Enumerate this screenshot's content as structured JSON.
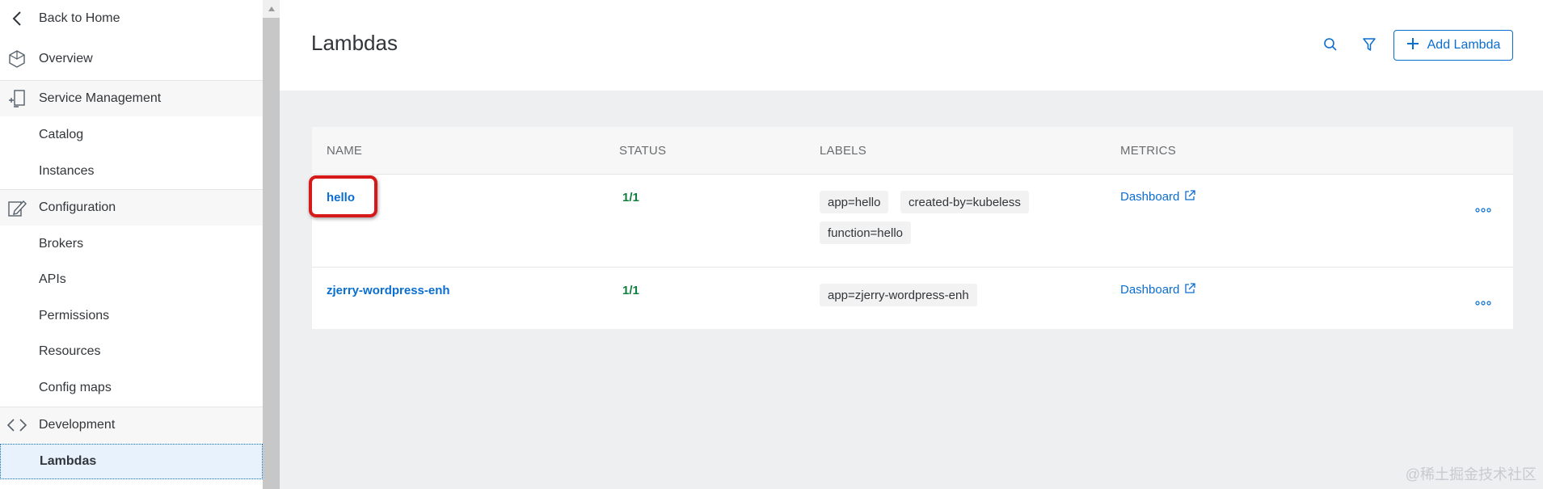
{
  "sidebar": {
    "back_label": "Back to Home",
    "items": [
      {
        "label": "Overview",
        "icon": "overview-icon"
      },
      {
        "label": "Service Management",
        "icon": "service-management-icon"
      },
      {
        "label": "Catalog"
      },
      {
        "label": "Instances"
      },
      {
        "label": "Configuration",
        "icon": "configuration-icon"
      },
      {
        "label": "Brokers"
      },
      {
        "label": "APIs"
      },
      {
        "label": "Permissions"
      },
      {
        "label": "Resources"
      },
      {
        "label": "Config maps"
      },
      {
        "label": "Development",
        "icon": "code-icon"
      },
      {
        "label": "Lambdas",
        "active": true
      }
    ]
  },
  "header": {
    "title": "Lambdas",
    "add_button_label": "Add Lambda"
  },
  "table": {
    "columns": [
      "NAME",
      "STATUS",
      "LABELS",
      "METRICS"
    ],
    "rows": [
      {
        "name": "hello",
        "status": "1/1",
        "labels": [
          "app=hello",
          "created-by=kubeless",
          "function=hello"
        ],
        "metrics": "Dashboard"
      },
      {
        "name": "zjerry-wordpress-enh",
        "status": "1/1",
        "labels": [
          "app=zjerry-wordpress-enh"
        ],
        "metrics": "Dashboard"
      }
    ]
  },
  "watermark": "@稀土掘金技术社区",
  "colors": {
    "accent": "#0a6ed1",
    "status_ok": "#107e3e",
    "highlight": "#d61a1a"
  }
}
